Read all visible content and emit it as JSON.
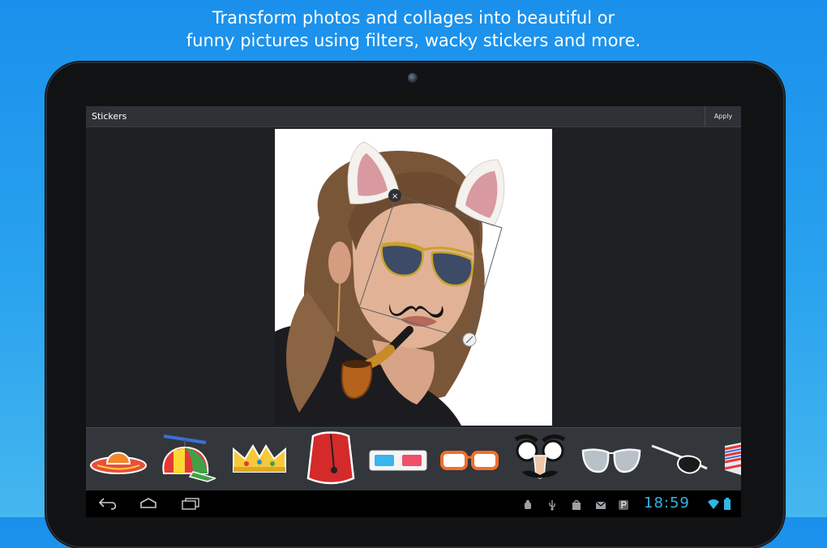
{
  "headline": {
    "line1": "Transform photos and collages into beautiful or",
    "line2": "funny pictures using filters, wacky stickers and more."
  },
  "actionbar": {
    "title": "Stickers",
    "apply_label": "Apply"
  },
  "editor": {
    "selected_sticker": "sunglasses-sticker",
    "stickers_on_photo": [
      "cat-ears-sticker",
      "sunglasses-sticker",
      "mustache-sticker",
      "pipe-sticker"
    ]
  },
  "tray": {
    "items": [
      "sombrero",
      "propeller-cap",
      "crown",
      "fez",
      "3d-glasses",
      "orange-glasses",
      "groucho-glasses",
      "aviator-sunglasses",
      "eye-patch",
      "striped-item"
    ]
  },
  "statusbar": {
    "time": "18:59"
  },
  "colors": {
    "background": "#1a90ec",
    "accent": "#33b5e5",
    "bezel": "#111214",
    "actionbar": "#2e3136"
  }
}
